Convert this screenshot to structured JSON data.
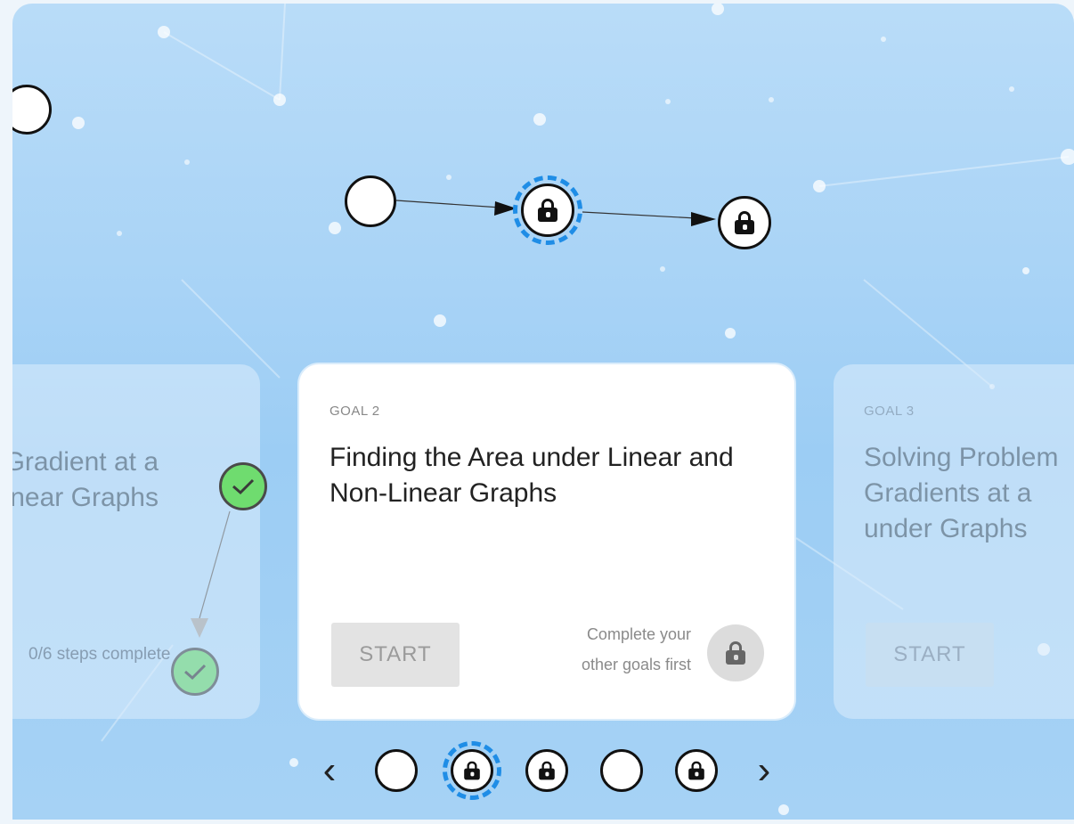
{
  "map": {
    "nodes": [
      {
        "state": "open",
        "icon": "circle"
      },
      {
        "state": "locked",
        "icon": "lock-icon",
        "selected": true
      },
      {
        "state": "locked",
        "icon": "lock-icon"
      }
    ]
  },
  "cards": {
    "prev": {
      "title_fragment": "Gradient at a\nnear Graphs",
      "steps": "0/6 steps complete",
      "status_icon": "check-icon"
    },
    "current": {
      "label": "GOAL 2",
      "title": "Finding the Area under Linear and Non-Linear Graphs",
      "button": "START",
      "note_line1": "Complete your",
      "note_line2": "other goals first",
      "status_icon": "lock-icon"
    },
    "next": {
      "label": "GOAL 3",
      "title_fragment": "Solving Problem\nGradients at a\nunder Graphs",
      "button": "START"
    }
  },
  "pager": {
    "prev_arrow": "‹",
    "next_arrow": "›",
    "dots": [
      {
        "state": "open"
      },
      {
        "state": "locked",
        "selected": true
      },
      {
        "state": "locked"
      },
      {
        "state": "open"
      },
      {
        "state": "locked"
      }
    ]
  },
  "colors": {
    "background": "#a8d3f6",
    "selected_ring": "#1f8de6",
    "complete": "#6fdc6f"
  }
}
